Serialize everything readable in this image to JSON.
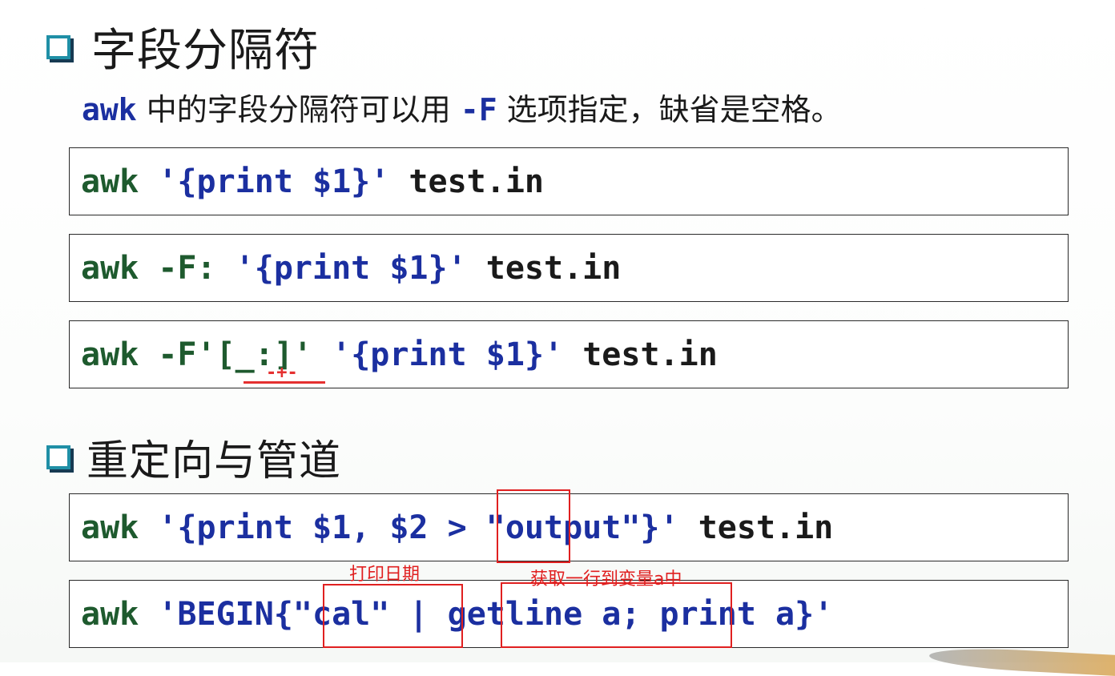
{
  "section1": {
    "title": "字段分隔符",
    "intro": {
      "kw1": "awk",
      "text1": " 中的字段分隔符可以用 ",
      "kw2": "-F",
      "text2": " 选项指定，缺省是空格。"
    },
    "lines": [
      {
        "cmd": "awk ",
        "q1": "'",
        "prog": "{print $1}",
        "q2": "'",
        "rest": " test.in"
      },
      {
        "cmd": "awk -F: ",
        "q1": "'",
        "prog": "{print $1}",
        "q2": "'",
        "rest": " test.in"
      },
      {
        "cmd": "awk -F",
        "q0": "'",
        "bracket": "[_:]",
        "q0b": "'",
        "sp": " ",
        "q1": "'",
        "prog": "{print $1}",
        "q2": "'",
        "rest": " test.in"
      }
    ],
    "annotation_mark": "-+-"
  },
  "section2": {
    "title": "重定向与管道",
    "lines": [
      {
        "cmd": "awk ",
        "q1": "'",
        "prog_a": "{print $1, $2 > ",
        "q3": "\"",
        "out": "output",
        "q4": "\"",
        "brace": "}",
        "q2": "'",
        "rest": " test.in"
      },
      {
        "cmd": "awk ",
        "q1": "'",
        "prog_a": "BEGIN{",
        "q3": "\"",
        "cal": "cal",
        "q4": "\"",
        "prog_b": " | getline a; print a}",
        "q2": "'"
      }
    ],
    "notes": {
      "print_date": "打印日期",
      "getline_note": "获取一行到变量a中"
    }
  },
  "colors": {
    "command": "#1e5a2e",
    "program": "#1b2fa0",
    "filename": "#1a1a1a",
    "annotation": "#e02020",
    "bullet": "#1f8fa6"
  }
}
